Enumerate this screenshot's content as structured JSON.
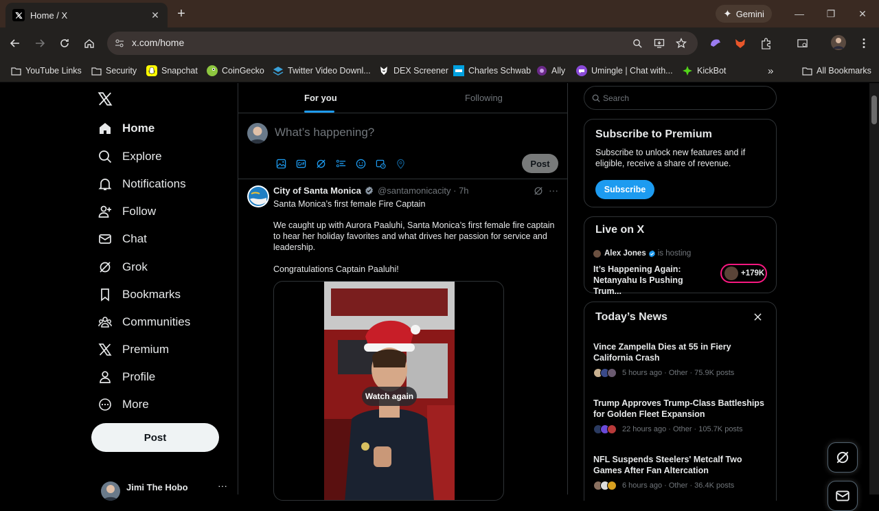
{
  "browser": {
    "tab_title": "Home / X",
    "url": "x.com/home",
    "gemini_label": "Gemini",
    "bookmarks": [
      {
        "label": "YouTube Links",
        "icon": "folder-icon"
      },
      {
        "label": "Security",
        "icon": "folder-icon"
      },
      {
        "label": "Snapchat",
        "icon": "snapchat-icon"
      },
      {
        "label": "CoinGecko",
        "icon": "coingecko-icon"
      },
      {
        "label": "Twitter Video Downl...",
        "icon": "download-icon"
      },
      {
        "label": "DEX Screener",
        "icon": "dexscreener-icon"
      },
      {
        "label": "Charles Schwab",
        "icon": "schwab-icon"
      },
      {
        "label": "Ally",
        "icon": "ally-icon"
      },
      {
        "label": "Umingle | Chat with...",
        "icon": "chat-icon"
      },
      {
        "label": "KickBot",
        "icon": "kickbot-icon"
      }
    ],
    "all_bookmarks": "All Bookmarks"
  },
  "nav": {
    "items": [
      {
        "label": "Home",
        "icon": "home-icon"
      },
      {
        "label": "Explore",
        "icon": "search-icon"
      },
      {
        "label": "Notifications",
        "icon": "bell-icon"
      },
      {
        "label": "Follow",
        "icon": "follow-icon"
      },
      {
        "label": "Chat",
        "icon": "mail-icon"
      },
      {
        "label": "Grok",
        "icon": "grok-icon"
      },
      {
        "label": "Bookmarks",
        "icon": "bookmark-icon"
      },
      {
        "label": "Communities",
        "icon": "communities-icon"
      },
      {
        "label": "Premium",
        "icon": "x-icon"
      },
      {
        "label": "Profile",
        "icon": "profile-icon"
      },
      {
        "label": "More",
        "icon": "more-icon"
      }
    ],
    "post_label": "Post",
    "account_name": "Jimi The Hobo",
    "account_more": "···"
  },
  "feed": {
    "tabs": [
      "For you",
      "Following"
    ],
    "compose_placeholder": "What’s happening?",
    "compose_post": "Post",
    "tweet": {
      "name": "City of Santa Monica",
      "handle": "@santamonicacity",
      "time": "· 7h",
      "line1": "Santa Monica’s first female Fire Captain",
      "line2": "We caught up with Aurora Paaluhi, Santa Monica’s first female fire captain to hear her holiday favorites and what drives her passion for service and leadership.",
      "line3": "Congratulations Captain Paaluhi!",
      "watch_again": "Watch again"
    }
  },
  "sidebar": {
    "search_placeholder": "Search",
    "premium": {
      "title": "Subscribe to Premium",
      "text": "Subscribe to unlock new features and if eligible, receive a share of revenue.",
      "button": "Subscribe"
    },
    "live": {
      "title": "Live on X",
      "host": "Alex Jones",
      "hosting": "is hosting",
      "stream_title": "It’s Happening Again: Netanyahu Is Pushing Trum...",
      "listeners": "+179K"
    },
    "news": {
      "title": "Today’s News",
      "items": [
        {
          "headline": "Vince Zampella Dies at 55 in Fiery California Crash",
          "meta": "5 hours ago · Other · 75.9K posts"
        },
        {
          "headline": "Trump Approves Trump-Class Battleships for Golden Fleet Expansion",
          "meta": "22 hours ago · Other · 105.7K posts"
        },
        {
          "headline": "NFL Suspends Steelers' Metcalf Two Games After Fan Altercation",
          "meta": "6 hours ago · Other · 36.4K posts"
        }
      ]
    }
  },
  "colors": {
    "accent": "#1d9bf0",
    "live": "#f91880",
    "bg": "#000000",
    "border": "#2f3336"
  }
}
